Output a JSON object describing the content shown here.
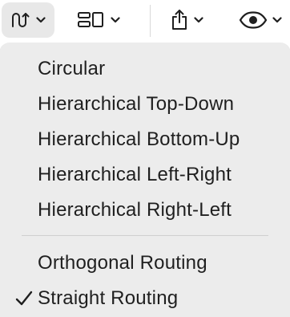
{
  "toolbar": {
    "layout_button": {
      "icon": "layout-routing-icon",
      "chevron": "chevron-down-icon"
    },
    "arrange_button": {
      "icon": "arrange-icon",
      "chevron": "chevron-down-icon"
    },
    "share_button": {
      "icon": "share-icon",
      "chevron": "chevron-down-icon"
    },
    "view_button": {
      "icon": "eye-icon",
      "chevron": "chevron-down-icon"
    }
  },
  "menu": {
    "layout_items": [
      {
        "label": "Circular"
      },
      {
        "label": "Hierarchical Top-Down"
      },
      {
        "label": "Hierarchical Bottom-Up"
      },
      {
        "label": "Hierarchical Left-Right"
      },
      {
        "label": "Hierarchical Right-Left"
      }
    ],
    "routing_items": [
      {
        "label": "Orthogonal Routing",
        "checked": false
      },
      {
        "label": "Straight Routing",
        "checked": true
      }
    ]
  }
}
